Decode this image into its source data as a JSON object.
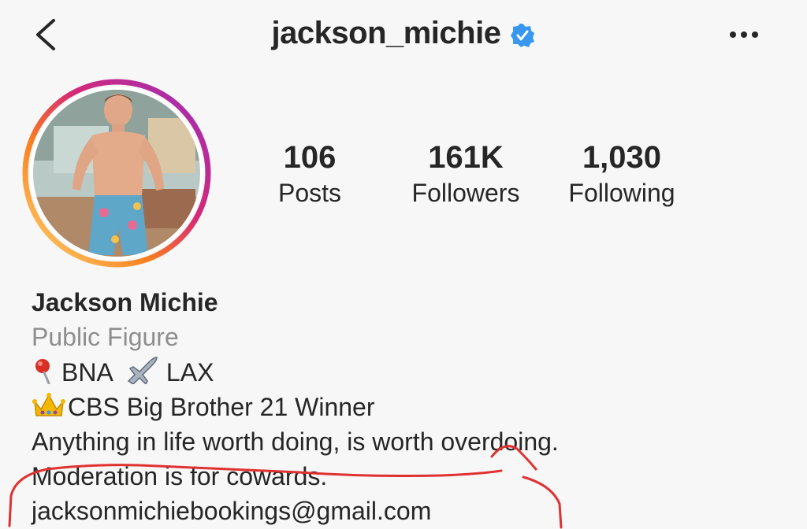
{
  "header": {
    "username": "jackson_michie",
    "verified": true,
    "back_icon": "chevron-left-icon",
    "more_icon": "more-horizontal-icon"
  },
  "profile": {
    "avatar_icon": "profile-photo",
    "stats": [
      {
        "value": "106",
        "label": "Posts"
      },
      {
        "value": "161K",
        "label": "Followers"
      },
      {
        "value": "1,030",
        "label": "Following"
      }
    ]
  },
  "bio": {
    "name": "Jackson Michie",
    "category": "Public Figure",
    "location_from": "BNA",
    "location_to": "LAX",
    "title_line": "CBS Big Brother 21 Winner",
    "quote_line1": "Anything in life worth doing, is worth overdoing.",
    "quote_line2": "Moderation is for cowards.",
    "email": "jacksonmichiebookings@gmail.com"
  },
  "colors": {
    "verified_blue": "#3897f0",
    "annotation_red": "#e03131",
    "secondary_text": "#8e8e8e"
  }
}
